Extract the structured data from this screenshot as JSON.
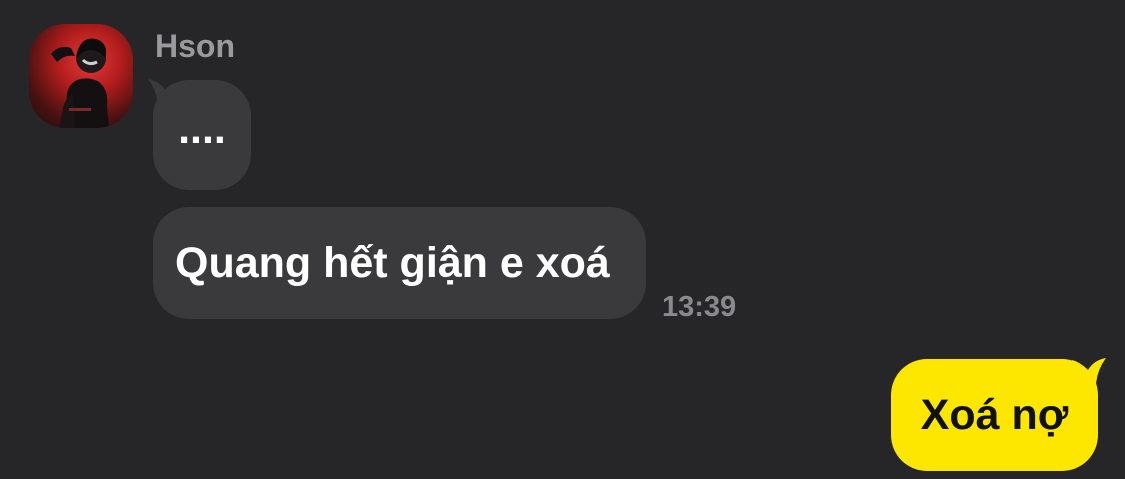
{
  "conversation": {
    "sender": {
      "name": "Hson",
      "avatar_icon": "profile-photo"
    },
    "messages": [
      {
        "direction": "incoming",
        "text": "...."
      },
      {
        "direction": "incoming",
        "text": "Quang hết giận e xoá",
        "time": "13:39"
      },
      {
        "direction": "outgoing",
        "text": "Xoá nợ"
      }
    ]
  },
  "colors": {
    "background": "#262628",
    "incoming_bubble": "#3a3a3c",
    "outgoing_bubble": "#fde600",
    "sender_name": "#9a9a9e",
    "timestamp": "#8a8a8e"
  }
}
